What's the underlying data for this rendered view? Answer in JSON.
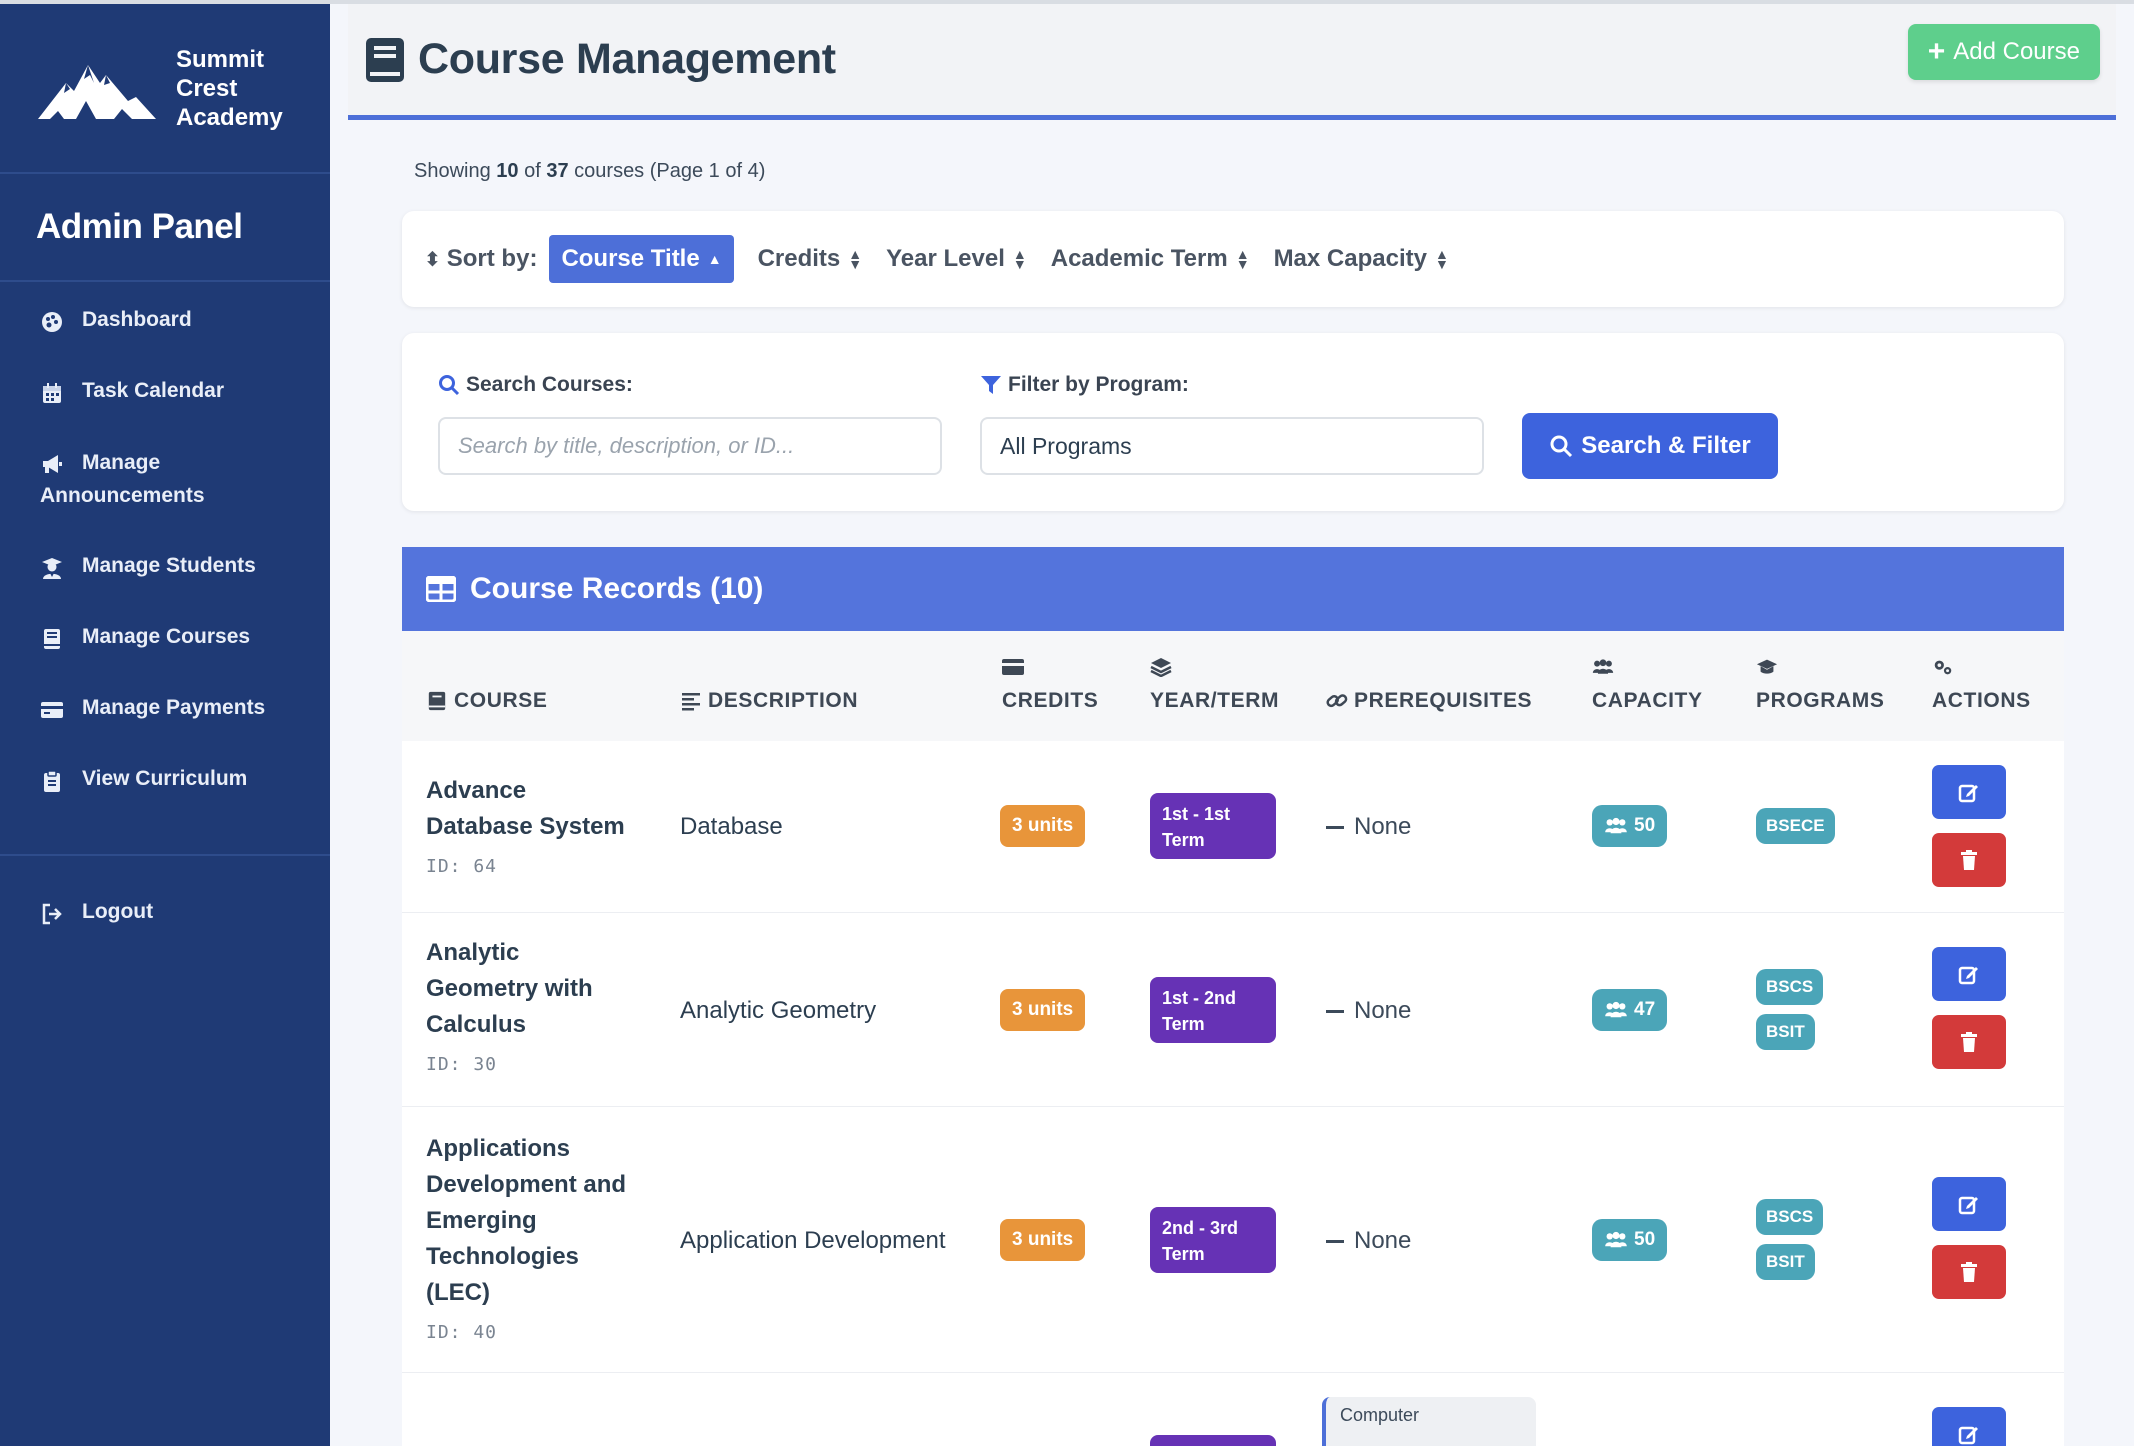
{
  "brand": {
    "line1": "Summit",
    "line2": "Crest",
    "line3": "Academy"
  },
  "sidebar": {
    "title": "Admin Panel",
    "items": [
      {
        "label": "Dashboard",
        "icon": "palette-icon"
      },
      {
        "label": "Task Calendar",
        "icon": "calendar-icon"
      },
      {
        "label_1": "Manage",
        "label_2": "Announcements",
        "icon": "megaphone-icon"
      },
      {
        "label": "Manage Students",
        "icon": "user-graduate-icon"
      },
      {
        "label": "Manage Courses",
        "icon": "book-icon"
      },
      {
        "label": "Manage Payments",
        "icon": "credit-card-icon"
      },
      {
        "label": "View Curriculum",
        "icon": "clipboard-icon"
      }
    ],
    "logout": "Logout"
  },
  "header": {
    "title": "Course Management",
    "add_button": "Add Course"
  },
  "summary": {
    "prefix": "Showing",
    "shown": "10",
    "of": "of",
    "total": "37",
    "suffix": "courses (Page 1 of 4)"
  },
  "sort": {
    "label": "Sort by:",
    "options": [
      "Course Title",
      "Credits",
      "Year Level",
      "Academic Term",
      "Max Capacity"
    ],
    "active": "Course Title"
  },
  "filters": {
    "search_label": "Search Courses:",
    "search_placeholder": "Search by title, description, or ID...",
    "program_label": "Filter by Program:",
    "program_value": "All Programs",
    "button": "Search & Filter"
  },
  "records": {
    "title": "Course Records (10)",
    "columns": [
      "COURSE",
      "DESCRIPTION",
      "CREDITS",
      "YEAR/TERM",
      "PREREQUISITES",
      "CAPACITY",
      "PROGRAMS",
      "ACTIONS"
    ],
    "rows": [
      {
        "title_lines": [
          "Advance",
          "Database System"
        ],
        "id": "ID: 64",
        "description": "Database",
        "credits": "3 units",
        "term_1": "1st - 1st",
        "term_2": "Term",
        "prereq": "None",
        "capacity": "50",
        "programs": [
          "BSECE"
        ]
      },
      {
        "title_lines": [
          "Analytic",
          "Geometry with",
          "Calculus"
        ],
        "id": "ID: 30",
        "description": "Analytic Geometry",
        "credits": "3 units",
        "term_1": "1st - 2nd",
        "term_2": "Term",
        "prereq": "None",
        "capacity": "47",
        "programs": [
          "BSCS",
          "BSIT"
        ]
      },
      {
        "title_lines": [
          "Applications",
          "Development and",
          "Emerging",
          "Technologies",
          "(LEC)"
        ],
        "id": "ID: 40",
        "description": "Application Development",
        "credits": "3 units",
        "term_1": "2nd - 3rd",
        "term_2": "Term",
        "prereq": "None",
        "capacity": "50",
        "programs": [
          "BSCS",
          "BSIT"
        ]
      }
    ],
    "partial_row": {
      "prereq_chip": "Computer"
    }
  },
  "colors": {
    "sidebar": "#1f3a75",
    "primary": "#4d6fd8",
    "success": "#5ecf8c",
    "danger": "#d33a3a",
    "warning": "#e8953a",
    "term": "#6632b5",
    "info": "#4ba5b8"
  }
}
